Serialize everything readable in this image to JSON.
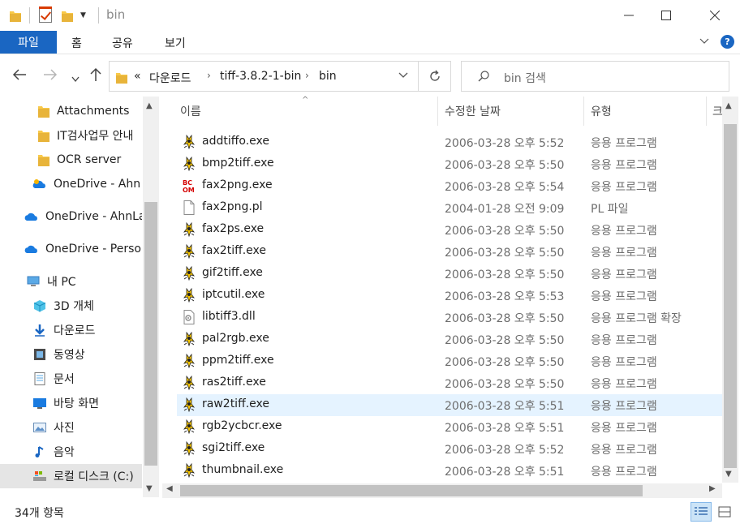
{
  "window": {
    "title": "bin"
  },
  "ribbon": {
    "file_tab": "파일",
    "tabs": [
      "홈",
      "공유",
      "보기"
    ]
  },
  "address": {
    "overflow": "«",
    "crumbs": [
      "다운로드",
      "tiff-3.8.2-1-bin",
      "bin"
    ]
  },
  "search": {
    "placeholder": "bin 검색"
  },
  "sidebar": {
    "items": [
      {
        "label": "Attachments",
        "icon": "folder-icon"
      },
      {
        "label": "IT검사업무 안내",
        "icon": "folder-icon"
      },
      {
        "label": "OCR server",
        "icon": "folder-icon"
      },
      {
        "label": "OneDrive - Ahn",
        "icon": "onedrive-icon"
      },
      {
        "label": "OneDrive - AhnLa",
        "icon": "onedrive-icon"
      },
      {
        "label": "OneDrive - Perso",
        "icon": "onedrive-icon"
      },
      {
        "label": "내 PC",
        "icon": "pc-icon"
      },
      {
        "label": "3D 개체",
        "icon": "3d-objects-icon"
      },
      {
        "label": "다운로드",
        "icon": "download-icon"
      },
      {
        "label": "동영상",
        "icon": "video-icon"
      },
      {
        "label": "문서",
        "icon": "document-icon"
      },
      {
        "label": "바탕 화면",
        "icon": "desktop-icon"
      },
      {
        "label": "사진",
        "icon": "pictures-icon"
      },
      {
        "label": "음악",
        "icon": "music-icon"
      },
      {
        "label": "로컬 디스크 (C:)",
        "icon": "drive-icon"
      }
    ]
  },
  "columns": {
    "name": "이름",
    "date": "수정한 날짜",
    "type": "유형",
    "size": "크"
  },
  "files": [
    {
      "name": "addtiffo.exe",
      "date": "2006-03-28 오후 5:52",
      "type": "응용 프로그램",
      "icon": "exe-icon"
    },
    {
      "name": "bmp2tiff.exe",
      "date": "2006-03-28 오후 5:50",
      "type": "응용 프로그램",
      "icon": "exe-icon"
    },
    {
      "name": "fax2png.exe",
      "date": "2006-03-28 오후 5:54",
      "type": "응용 프로그램",
      "icon": "png-exe-icon"
    },
    {
      "name": "fax2png.pl",
      "date": "2004-01-28 오전 9:09",
      "type": "PL 파일",
      "icon": "file-icon"
    },
    {
      "name": "fax2ps.exe",
      "date": "2006-03-28 오후 5:50",
      "type": "응용 프로그램",
      "icon": "exe-icon"
    },
    {
      "name": "fax2tiff.exe",
      "date": "2006-03-28 오후 5:50",
      "type": "응용 프로그램",
      "icon": "exe-icon"
    },
    {
      "name": "gif2tiff.exe",
      "date": "2006-03-28 오후 5:50",
      "type": "응용 프로그램",
      "icon": "exe-icon"
    },
    {
      "name": "iptcutil.exe",
      "date": "2006-03-28 오후 5:53",
      "type": "응용 프로그램",
      "icon": "exe-icon"
    },
    {
      "name": "libtiff3.dll",
      "date": "2006-03-28 오후 5:50",
      "type": "응용 프로그램 확장",
      "icon": "dll-icon"
    },
    {
      "name": "pal2rgb.exe",
      "date": "2006-03-28 오후 5:50",
      "type": "응용 프로그램",
      "icon": "exe-icon"
    },
    {
      "name": "ppm2tiff.exe",
      "date": "2006-03-28 오후 5:50",
      "type": "응용 프로그램",
      "icon": "exe-icon"
    },
    {
      "name": "ras2tiff.exe",
      "date": "2006-03-28 오후 5:50",
      "type": "응용 프로그램",
      "icon": "exe-icon"
    },
    {
      "name": "raw2tiff.exe",
      "date": "2006-03-28 오후 5:51",
      "type": "응용 프로그램",
      "icon": "exe-icon",
      "selected": true
    },
    {
      "name": "rgb2ycbcr.exe",
      "date": "2006-03-28 오후 5:51",
      "type": "응용 프로그램",
      "icon": "exe-icon"
    },
    {
      "name": "sgi2tiff.exe",
      "date": "2006-03-28 오후 5:52",
      "type": "응용 프로그램",
      "icon": "exe-icon"
    },
    {
      "name": "thumbnail.exe",
      "date": "2006-03-28 오후 5:51",
      "type": "응용 프로그램",
      "icon": "exe-icon"
    }
  ],
  "status": {
    "item_count": "34개 항목"
  },
  "colors": {
    "accent": "#1a66c2",
    "selected_row": "#e5f3ff",
    "folder": "#f8c94a"
  }
}
